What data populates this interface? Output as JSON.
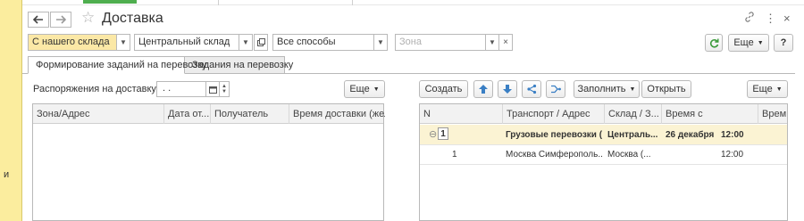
{
  "window": {
    "title": "Доставка",
    "icons": {
      "back": "arrow-left-icon",
      "forward": "arrow-right-icon",
      "star": "star-icon",
      "link": "link-icon",
      "more": "more-vertical-icon",
      "close": "close-icon"
    }
  },
  "side_panel": {
    "label": "и"
  },
  "filters": {
    "source": "С нашего склада",
    "warehouse": "Центральный склад",
    "method": "Все способы",
    "zone_placeholder": "Зона"
  },
  "top_actions": {
    "more_label": "Еще",
    "help_label": "?"
  },
  "tabs": [
    {
      "label": "Формирование заданий на перевозку",
      "active": true
    },
    {
      "label": "Задания на перевозку",
      "active": false
    }
  ],
  "left_panel": {
    "date_label": "Распоряжения на доставку до:",
    "date_value": ". .",
    "more_label": "Еще",
    "columns": [
      "Зона/Адрес",
      "Дата от...",
      "Получатель",
      "Время доставки (жела"
    ]
  },
  "right_panel": {
    "toolbar": {
      "create_label": "Создать",
      "fill_label": "Заполнить",
      "open_label": "Открыть",
      "more_label": "Еще"
    },
    "columns": [
      "N",
      "Транспорт / Адрес",
      "Склад / З...",
      "Время с",
      "Врем"
    ],
    "rows": [
      {
        "group_index": "1",
        "n": "",
        "transport": "Грузовые перевозки (...",
        "warehouse": "Централь...",
        "date": "26 декабря",
        "time": "12:00",
        "bold": true
      },
      {
        "n": "1",
        "transport": "Москва Симферополь...",
        "warehouse": "Москва (...",
        "date": "",
        "time": "12:00",
        "bold": false
      }
    ]
  },
  "colors": {
    "accent_yellow": "#fbed9e",
    "field_yellow": "#fbe8a6",
    "refresh_green": "#3a9a3a",
    "nav_blue": "#3a7fc4"
  }
}
